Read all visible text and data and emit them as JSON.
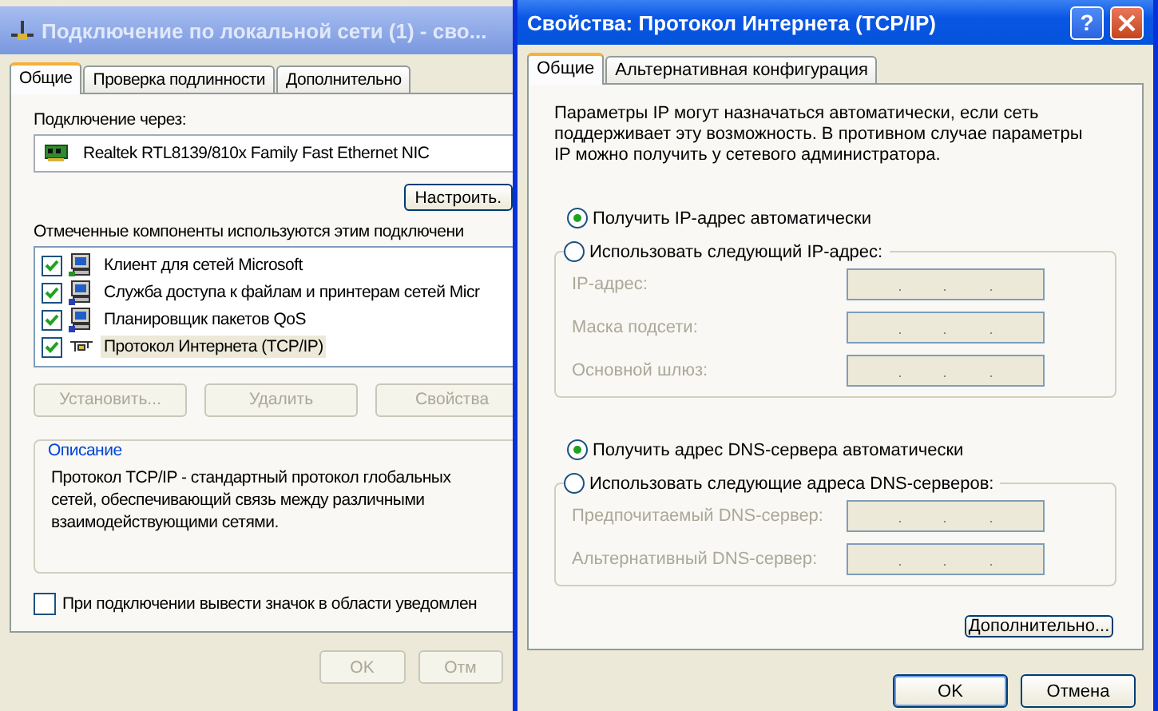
{
  "connection_dialog": {
    "title": "Подключение по локальной сети (1) - сво...",
    "tabs": [
      {
        "label": "Общие",
        "selected": true
      },
      {
        "label": "Проверка подлинности",
        "selected": false
      },
      {
        "label": "Дополнительно",
        "selected": false
      }
    ],
    "connect_label": "Подключение через:",
    "adapter": "Realtek RTL8139/810x Family Fast Ethernet NIC",
    "configure_button": "Настроить.",
    "components_label": "Отмеченные компоненты используются этим подключени",
    "components": [
      {
        "kind": "client",
        "label": "Клиент для сетей Microsoft",
        "checked": true,
        "selected": false
      },
      {
        "kind": "service",
        "label": "Служба доступа к файлам и принтерам сетей Micr",
        "checked": true,
        "selected": false
      },
      {
        "kind": "service",
        "label": "Планировщик пакетов QoS",
        "checked": true,
        "selected": false
      },
      {
        "kind": "protocol",
        "label": "Протокол Интернета (TCP/IP)",
        "checked": true,
        "selected": true
      }
    ],
    "action_buttons": [
      {
        "label": "Установить...",
        "disabled": true
      },
      {
        "label": "Удалить",
        "disabled": true
      },
      {
        "label": "Свойства",
        "disabled": true
      }
    ],
    "description": {
      "title": "Описание",
      "text": "Протокол TCP/IP - стандартный протокол глобальных сетей, обеспечивающий связь между различными взаимодействующими сетями."
    },
    "notify_checkbox": {
      "label": "При подключении вывести значок в области уведомлен",
      "checked": false
    },
    "buttons": [
      {
        "label": "OK",
        "disabled": true
      },
      {
        "label": "Отм",
        "disabled": true
      }
    ]
  },
  "tcpip_dialog": {
    "title": "Свойства: Протокол Интернета (TCP/IP)",
    "help_button": "?",
    "tabs": [
      {
        "label": "Общие",
        "selected": true
      },
      {
        "label": "Альтернативная конфигурация",
        "selected": false
      }
    ],
    "intro": "Параметры IP могут назначаться автоматически, если сеть поддерживает эту возможность. В противном случае параметры IP можно получить у сетевого администратора.",
    "ip_options": [
      {
        "label": "Получить IP-адрес автоматически",
        "selected": true
      },
      {
        "label": "Использовать следующий IP-адрес:",
        "selected": false
      }
    ],
    "ip_fields": [
      {
        "label": "IP-адрес:",
        "disabled": true
      },
      {
        "label": "Маска подсети:",
        "disabled": true
      },
      {
        "label": "Основной шлюз:",
        "disabled": true
      }
    ],
    "dns_options": [
      {
        "label": "Получить адрес DNS-сервера автоматически",
        "selected": true
      },
      {
        "label": "Использовать следующие адреса DNS-серверов:",
        "selected": false
      }
    ],
    "dns_fields": [
      {
        "label": "Предпочитаемый DNS-сервер:",
        "disabled": true
      },
      {
        "label": "Альтернативный DNS-сервер:",
        "disabled": true
      }
    ],
    "advanced_button": "Дополнительно...",
    "buttons": [
      {
        "label": "OK",
        "default": true
      },
      {
        "label": "Отмена",
        "default": false
      }
    ]
  }
}
